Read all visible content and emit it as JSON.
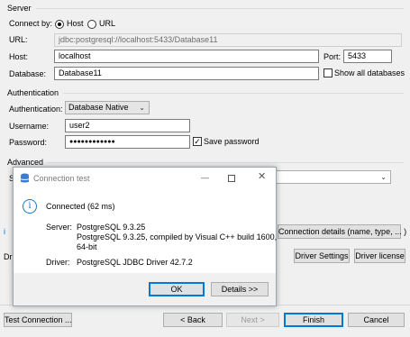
{
  "server": {
    "section_label": "Server",
    "connect_by_label": "Connect by:",
    "host_radio_label": "Host",
    "url_radio_label": "URL",
    "url_label": "URL:",
    "url_value": "jdbc:postgresql://localhost:5433/Database11",
    "host_label": "Host:",
    "host_value": "localhost",
    "port_label": "Port:",
    "port_value": "5433",
    "database_label": "Database:",
    "database_value": "Database11",
    "show_all_label": "Show all databases"
  },
  "auth": {
    "section_label": "Authentication",
    "auth_label": "Authentication:",
    "auth_value": "Database Native",
    "username_label": "Username:",
    "username_value": "user2",
    "password_label": "Password:",
    "password_value": "●●●●●●●●●●●●",
    "save_password_label": "Save password"
  },
  "advanced": {
    "section_label": "Advanced",
    "s_label": "S",
    "i_label": "i",
    "dri_label": "Dri",
    "connection_details_button": "Connection details (name, type, ... )",
    "driver_settings_button": "Driver Settings",
    "driver_license_button": "Driver license"
  },
  "dialog": {
    "title": "Connection test",
    "status": "Connected (62 ms)",
    "server_label": "Server:",
    "server_line1": "PostgreSQL 9.3.25",
    "server_line2": "PostgreSQL 9.3.25, compiled by Visual C++ build 1600,",
    "server_line3": "64-bit",
    "driver_label": "Driver:",
    "driver_value": "PostgreSQL JDBC Driver 42.7.2",
    "ok_button": "OK",
    "details_button": "Details >>"
  },
  "footer": {
    "test_connection_button": "Test Connection ...",
    "back_button": "< Back",
    "next_button": "Next >",
    "finish_button": "Finish",
    "cancel_button": "Cancel"
  }
}
